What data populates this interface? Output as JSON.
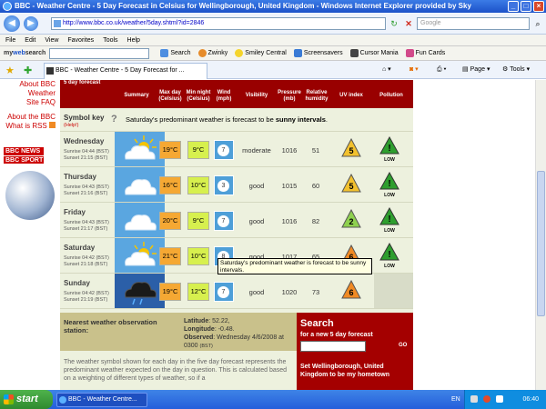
{
  "window": {
    "title": "BBC - Weather Centre - 5 Day Forecast in Celsius for Wellingborough, United Kingdom - Windows Internet Explorer provided by Sky"
  },
  "address": {
    "url": "http://www.bbc.co.uk/weather/5day.shtml?id=2846",
    "search_placeholder": "Google"
  },
  "menu": [
    "File",
    "Edit",
    "View",
    "Favorites",
    "Tools",
    "Help"
  ],
  "linksbar": {
    "brand_a": "my",
    "brand_b": "web",
    "brand_c": "search",
    "items": [
      "Search",
      "Zwinky",
      "Smiley Central",
      "Screensavers",
      "Cursor Mania",
      "Fun Cards"
    ]
  },
  "tab": {
    "label": "BBC - Weather Centre - 5 Day Forecast for ..."
  },
  "commands": {
    "page": "Page",
    "tools": "Tools"
  },
  "leftnav": {
    "links": [
      "About BBC",
      "Weather",
      "Site FAQ",
      "About the BBC",
      "What is RSS"
    ],
    "bbc_news": "BBC NEWS",
    "bbc_sport": "BBC SPORT"
  },
  "forecast": {
    "header_label": "5 day forecast",
    "columns": {
      "summary": "Summary",
      "max": "Max day (Celsius)",
      "min": "Min night (Celsius)",
      "wind": "Wind (mph)",
      "visibility": "Visibility",
      "pressure": "Pressure (mb)",
      "humidity": "Relative humidity",
      "uv": "UV index",
      "pollution": "Pollution"
    },
    "symbol_key": {
      "title": "Symbol key",
      "help": "(Help!)",
      "text_a": "Saturday's predominant weather is forecast to be ",
      "text_b": "sunny intervals",
      "text_c": "."
    },
    "days": [
      {
        "name": "Wednesday",
        "sunrise": "Sunrise 04:44 (BST)",
        "sunset": "Sunset 21:15 (BST)",
        "max": "19°C",
        "min": "9°C",
        "wind": "7",
        "visibility": "moderate",
        "pressure": "1016",
        "humidity": "51",
        "uv": "5",
        "pollution": "LOW",
        "symbol": "sunny-intervals"
      },
      {
        "name": "Thursday",
        "sunrise": "Sunrise 04:43 (BST)",
        "sunset": "Sunset 21:16 (BST)",
        "max": "16°C",
        "min": "10°C",
        "wind": "3",
        "visibility": "good",
        "pressure": "1015",
        "humidity": "60",
        "uv": "5",
        "pollution": "LOW",
        "symbol": "cloudy"
      },
      {
        "name": "Friday",
        "sunrise": "Sunrise 04:43 (BST)",
        "sunset": "Sunset 21:17 (BST)",
        "max": "20°C",
        "min": "9°C",
        "wind": "7",
        "visibility": "good",
        "pressure": "1016",
        "humidity": "82",
        "uv": "2",
        "pollution": "LOW",
        "symbol": "cloudy"
      },
      {
        "name": "Saturday",
        "sunrise": "Sunrise 04:42 (BST)",
        "sunset": "Sunset 21:18 (BST)",
        "max": "21°C",
        "min": "10°C",
        "wind": "8",
        "visibility": "good",
        "pressure": "1017",
        "humidity": "65",
        "uv": "6",
        "pollution": "LOW",
        "symbol": "sunny-intervals"
      },
      {
        "name": "Sunday",
        "sunrise": "Sunrise 04:42 (BST)",
        "sunset": "Sunset 21:19 (BST)",
        "max": "19°C",
        "min": "12°C",
        "wind": "7",
        "visibility": "good",
        "pressure": "1020",
        "humidity": "73",
        "uv": "6",
        "pollution": "",
        "symbol": "light-rain"
      }
    ],
    "tooltip": "Saturday's predominant weather is forecast to be sunny intervals."
  },
  "observation": {
    "title": "Nearest weather observation station:",
    "lat_label": "Latitude",
    "lat": ": 52.22,",
    "lon_label": "Longitude",
    "lon": ": -0.48.",
    "obs_label": "Observed",
    "obs": ": Wednesday 4/6/2008 at 0300",
    "obs_tz": "(BST)"
  },
  "search_panel": {
    "title": "Search",
    "subtitle": "for a new 5 day forecast",
    "go": "GO",
    "set_home": "Set Wellingborough, United Kingdom to be my hometown"
  },
  "bottom_text": "The weather symbol shown for each day in the five day forecast represents the predominant weather expected on the day in question. This is calculated based on a weighting of different types of weather, so if a",
  "taskbar": {
    "start": "start",
    "task": "BBC - Weather Centre...",
    "lang": "EN",
    "clock": "06:40"
  },
  "colors": {
    "bbc_red": "#990000",
    "uv_yellow": "#f2c12e",
    "uv_green": "#8fd14f",
    "uv_orange": "#f08a24",
    "pollution_green": "#2e9e2e"
  }
}
